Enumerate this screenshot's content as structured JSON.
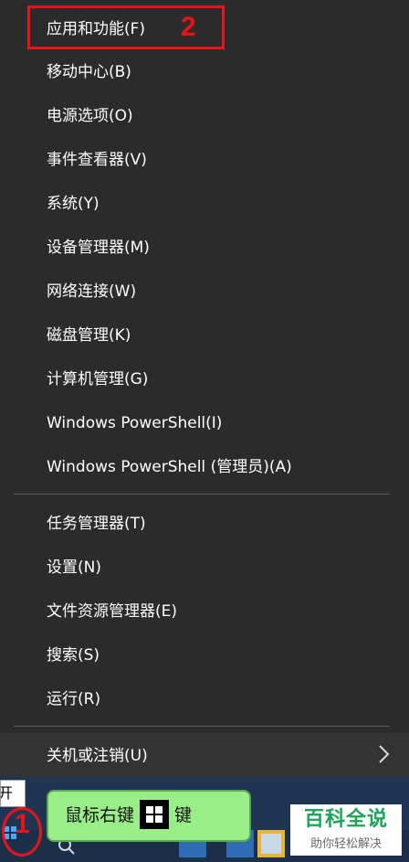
{
  "menu": {
    "items": [
      "应用和功能(F)",
      "移动中心(B)",
      "电源选项(O)",
      "事件查看器(V)",
      "系统(Y)",
      "设备管理器(M)",
      "网络连接(W)",
      "磁盘管理(K)",
      "计算机管理(G)",
      "Windows PowerShell(I)",
      "Windows PowerShell (管理员)(A)",
      "任务管理器(T)",
      "设置(N)",
      "文件资源管理器(E)",
      "搜索(S)",
      "运行(R)",
      "关机或注销(U)"
    ]
  },
  "annotations": {
    "step1": "1",
    "step2": "2",
    "callout_before": "鼠标右键",
    "callout_after": "键"
  },
  "taskbar": {
    "start_tooltip": "开始"
  },
  "watermark": {
    "title": "百科全说",
    "subtitle": "助你轻松解决"
  },
  "colors": {
    "menu_bg": "#2b2b2b",
    "highlight_red": "#e8141a",
    "callout_green": "#99ee88",
    "taskbar_blue": "#1f3552",
    "watermark_green": "#1ea35a"
  }
}
